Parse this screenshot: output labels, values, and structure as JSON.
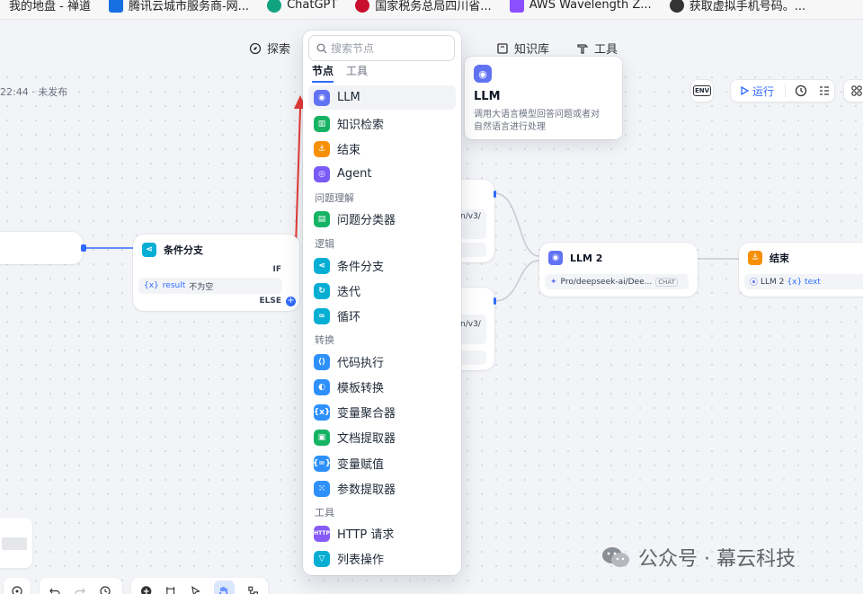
{
  "bookmarks": [
    {
      "label": "我的地盘 - 禅道",
      "color": "#1b73c7"
    },
    {
      "label": "腾讯云城市服务商-网...",
      "color": "#1670e2"
    },
    {
      "label": "ChatGPT",
      "color": "#10a37f"
    },
    {
      "label": "国家税务总局四川省...",
      "color": "#c8102e"
    },
    {
      "label": "AWS Wavelength Z...",
      "color": "#8c4fff"
    },
    {
      "label": "获取虚拟手机号码。...",
      "color": "#333333"
    }
  ],
  "header": {
    "explore": "探索",
    "knowledge": "知识库",
    "tools": "工具"
  },
  "status": {
    "save_time": "22:44 · 未发布"
  },
  "toolbar": {
    "env": "ENV",
    "run": "运行"
  },
  "nodes": {
    "condition": {
      "title": "条件分支",
      "if_label": "IF",
      "var_tag": "{x}",
      "condition_var": "result",
      "condition_text": "不为空",
      "else_label": "ELSE"
    },
    "hidden_top": {
      "text": "n/v3/"
    },
    "hidden_bottom": {
      "text": "n/v3/"
    },
    "llm2": {
      "title": "LLM 2",
      "model": "Pro/deepseek-ai/Dee...",
      "badge": "CHAT"
    },
    "end": {
      "title": "结束",
      "ref_node": "LLM 2",
      "ref_var": "{x} text"
    }
  },
  "dropdown": {
    "search_placeholder": "搜索节点",
    "tabs": [
      {
        "label": "节点",
        "active": true
      },
      {
        "label": "工具",
        "active": false
      }
    ],
    "items": [
      {
        "label": "LLM",
        "color": "#6172f3",
        "icon": "llm-icon"
      },
      {
        "label": "知识检索",
        "color": "#16b364",
        "icon": "knowledge-retrieval-icon"
      },
      {
        "label": "结束",
        "color": "#f79009",
        "icon": "end-icon"
      },
      {
        "label": "Agent",
        "color": "#7a5af8",
        "icon": "agent-icon"
      }
    ],
    "groups": [
      {
        "label": "问题理解",
        "items": [
          {
            "label": "问题分类器",
            "color": "#16b364",
            "icon": "question-classifier-icon"
          }
        ]
      },
      {
        "label": "逻辑",
        "items": [
          {
            "label": "条件分支",
            "color": "#06aed4",
            "icon": "if-else-icon"
          },
          {
            "label": "迭代",
            "color": "#06aed4",
            "icon": "iteration-icon"
          },
          {
            "label": "循环",
            "color": "#06aed4",
            "icon": "loop-icon"
          }
        ]
      },
      {
        "label": "转换",
        "items": [
          {
            "label": "代码执行",
            "color": "#2e90fa",
            "icon": "code-icon"
          },
          {
            "label": "模板转换",
            "color": "#2e90fa",
            "icon": "template-icon"
          },
          {
            "label": "变量聚合器",
            "color": "#2e90fa",
            "icon": "variable-aggregator-icon"
          },
          {
            "label": "文档提取器",
            "color": "#16b364",
            "icon": "doc-extractor-icon"
          },
          {
            "label": "变量赋值",
            "color": "#2e90fa",
            "icon": "variable-assign-icon"
          },
          {
            "label": "参数提取器",
            "color": "#2e90fa",
            "icon": "parameter-extractor-icon"
          }
        ]
      },
      {
        "label": "工具",
        "items": [
          {
            "label": "HTTP 请求",
            "color": "#875bf7",
            "icon": "http-icon"
          },
          {
            "label": "列表操作",
            "color": "#06aed4",
            "icon": "list-operator-icon"
          }
        ]
      }
    ]
  },
  "tooltip": {
    "title": "LLM",
    "description_line1": "调用大语言模型回答问题或者对",
    "description_line2": "自然语言进行处理"
  },
  "watermark": {
    "text": "公众号 · 幕云科技"
  }
}
